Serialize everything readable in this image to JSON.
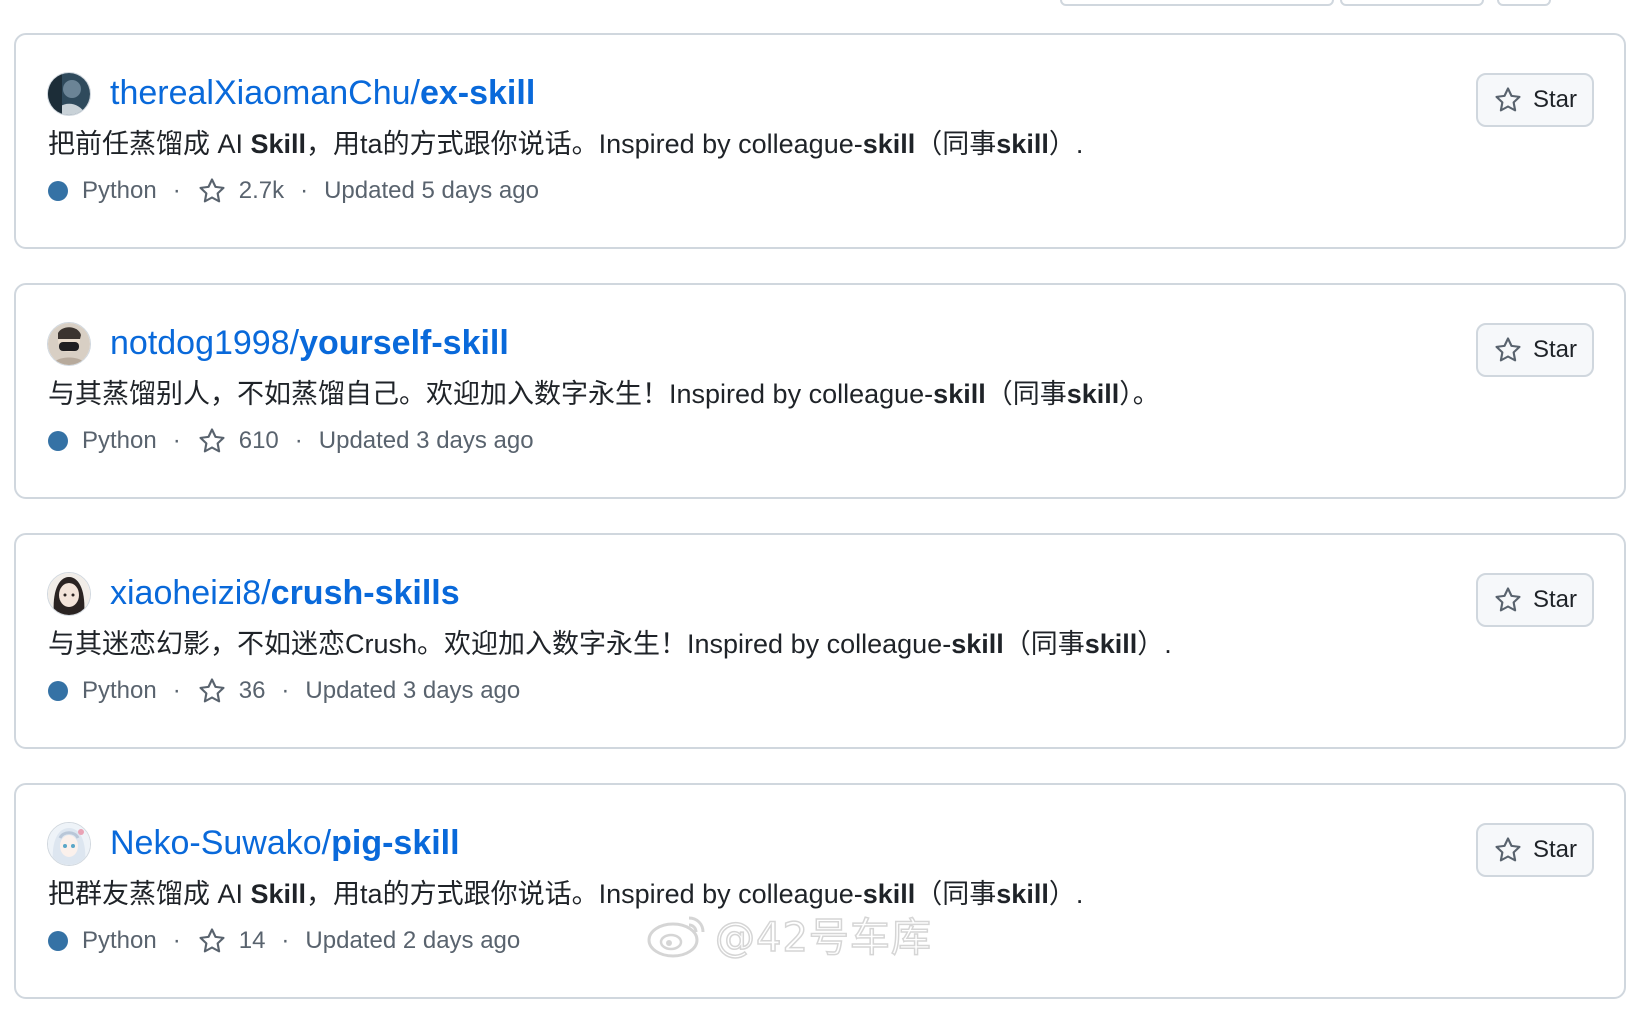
{
  "colors": {
    "link": "#0969da",
    "lang_python": "#3572A5",
    "border": "#d0d7de",
    "muted": "#59636e"
  },
  "repos": [
    {
      "owner": "therealXiaomanChu/",
      "name": "ex-skill",
      "desc_prefix": "把前任蒸馏成 AI ",
      "desc_bold": "Skill",
      "desc_middle": "，用ta的方式跟你说话。Inspired by colleague-",
      "desc_bold2": "skill",
      "desc_paren_open": "（同事",
      "desc_bold3": "skill",
      "desc_suffix": "）.",
      "language": "Python",
      "stars": "2.7k",
      "updated": "Updated 5 days ago",
      "star_label": "Star",
      "avatar_icon": "avatar-dark-photo"
    },
    {
      "owner": "notdog1998/",
      "name": "yourself-skill",
      "desc_prefix": "与其蒸馏别人，不如蒸馏自己。欢迎加入数字永生！Inspired by colleague-",
      "desc_bold": "skill",
      "desc_middle": "（同事",
      "desc_bold2": "skill",
      "desc_paren_open": "",
      "desc_bold3": "",
      "desc_suffix": "）。",
      "language": "Python",
      "stars": "610",
      "updated": "Updated 3 days ago",
      "star_label": "Star",
      "avatar_icon": "avatar-masked-person"
    },
    {
      "owner": "xiaoheizi8/",
      "name": "crush-skills",
      "desc_prefix": "与其迷恋幻影，不如迷恋Crush。欢迎加入数字永生！Inspired by colleague-",
      "desc_bold": "skill",
      "desc_middle": "（同事",
      "desc_bold2": "skill",
      "desc_paren_open": "",
      "desc_bold3": "",
      "desc_suffix": "）.",
      "language": "Python",
      "stars": "36",
      "updated": "Updated 3 days ago",
      "star_label": "Star",
      "avatar_icon": "avatar-anime-girl"
    },
    {
      "owner": "Neko-Suwako/",
      "name": "pig-skill",
      "desc_prefix": "把群友蒸馏成 AI ",
      "desc_bold": "Skill",
      "desc_middle": "，用ta的方式跟你说话。Inspired by colleague-",
      "desc_bold2": "skill",
      "desc_paren_open": "（同事",
      "desc_bold3": "skill",
      "desc_suffix": "）.",
      "language": "Python",
      "stars": "14",
      "updated": "Updated 2 days ago",
      "star_label": "Star",
      "avatar_icon": "avatar-anime-white-hair"
    }
  ],
  "watermark": {
    "text": "@42号车库",
    "icon": "weibo-logo-icon"
  }
}
